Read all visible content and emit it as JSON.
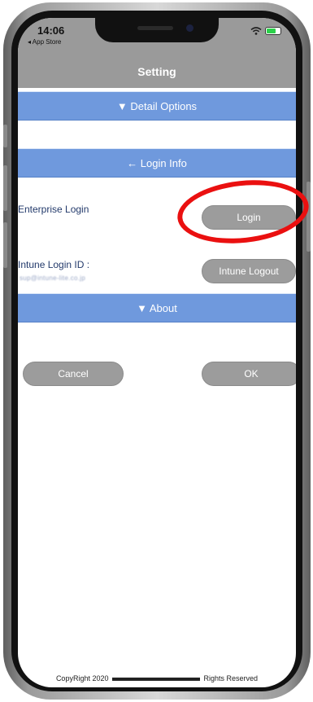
{
  "status_bar": {
    "time": "14:06",
    "back_to_app": "◂ App Store"
  },
  "header": {
    "title": "Setting"
  },
  "sections": {
    "detail_options": "▼ Detail Options",
    "login_info": "← Login Info",
    "about": "▼ About"
  },
  "login": {
    "enterprise_label": "Enterprise Login",
    "login_button": "Login",
    "intune_label": "Intune Login ID :",
    "intune_email": "sup@intune-lite.co.jp",
    "intune_logout_button": "Intune Logout"
  },
  "actions": {
    "cancel": "Cancel",
    "ok": "OK"
  },
  "footer": {
    "copyright_left": "CopyRight 2020",
    "copyright_right": "Rights Reserved"
  },
  "colors": {
    "header_gray": "#9a9a9a",
    "section_blue": "#6f99dd",
    "button_gray": "#9c9c9c",
    "highlight_red": "#ea1010"
  }
}
